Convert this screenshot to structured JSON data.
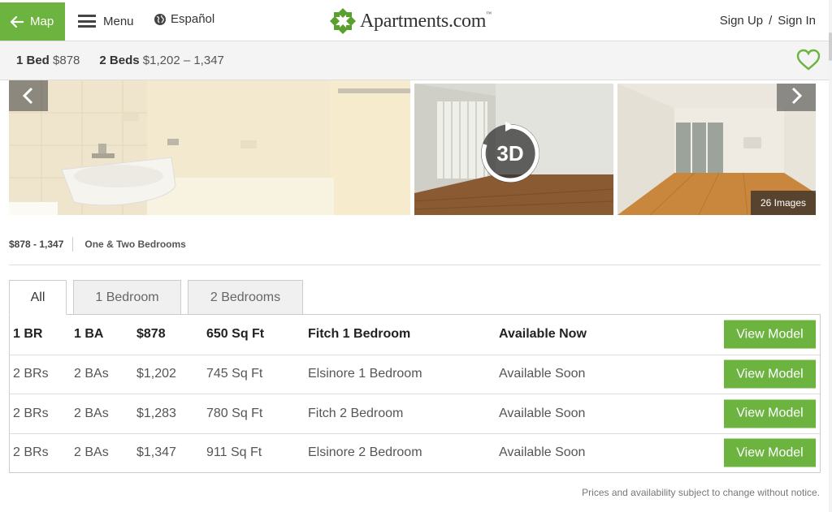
{
  "header": {
    "map_label": "Map",
    "menu_label": "Menu",
    "language_label": "Español",
    "logo_text": "Apartments.com",
    "logo_tm": "™",
    "sign_up": "Sign Up",
    "auth_separator": "/",
    "sign_in": "Sign In"
  },
  "subbar": {
    "bed1_label": "1 Bed",
    "bed1_price": "$878",
    "bed2_label": "2 Beds",
    "bed2_price": "$1,202 – 1,347"
  },
  "gallery": {
    "badge_3d": "3D",
    "image_count": "26 Images"
  },
  "summary": {
    "price_range": "$878 - 1,347",
    "bedrooms": "One & Two Bedrooms"
  },
  "tabs": [
    {
      "label": "All"
    },
    {
      "label": "1 Bedroom"
    },
    {
      "label": "2 Bedrooms"
    }
  ],
  "units": [
    {
      "beds": "1 BR",
      "baths": "1 BA",
      "price": "$878",
      "sqft": "650 Sq Ft",
      "name": "Fitch 1 Bedroom",
      "availability": "Available Now",
      "button": "View Model"
    },
    {
      "beds": "2 BRs",
      "baths": "2 BAs",
      "price": "$1,202",
      "sqft": "745 Sq Ft",
      "name": "Elsinore 1 Bedroom",
      "availability": "Available Soon",
      "button": "View Model"
    },
    {
      "beds": "2 BRs",
      "baths": "2 BAs",
      "price": "$1,283",
      "sqft": "780 Sq Ft",
      "name": "Fitch 2 Bedroom",
      "availability": "Available Soon",
      "button": "View Model"
    },
    {
      "beds": "2 BRs",
      "baths": "2 BAs",
      "price": "$1,347",
      "sqft": "911 Sq Ft",
      "name": "Elsinore 2 Bedroom",
      "availability": "Available Soon",
      "button": "View Model"
    }
  ],
  "disclaimer": "Prices and availability subject to change without notice.",
  "colors": {
    "brand_green": "#6db33f",
    "logo_green": "#5aa02c"
  }
}
